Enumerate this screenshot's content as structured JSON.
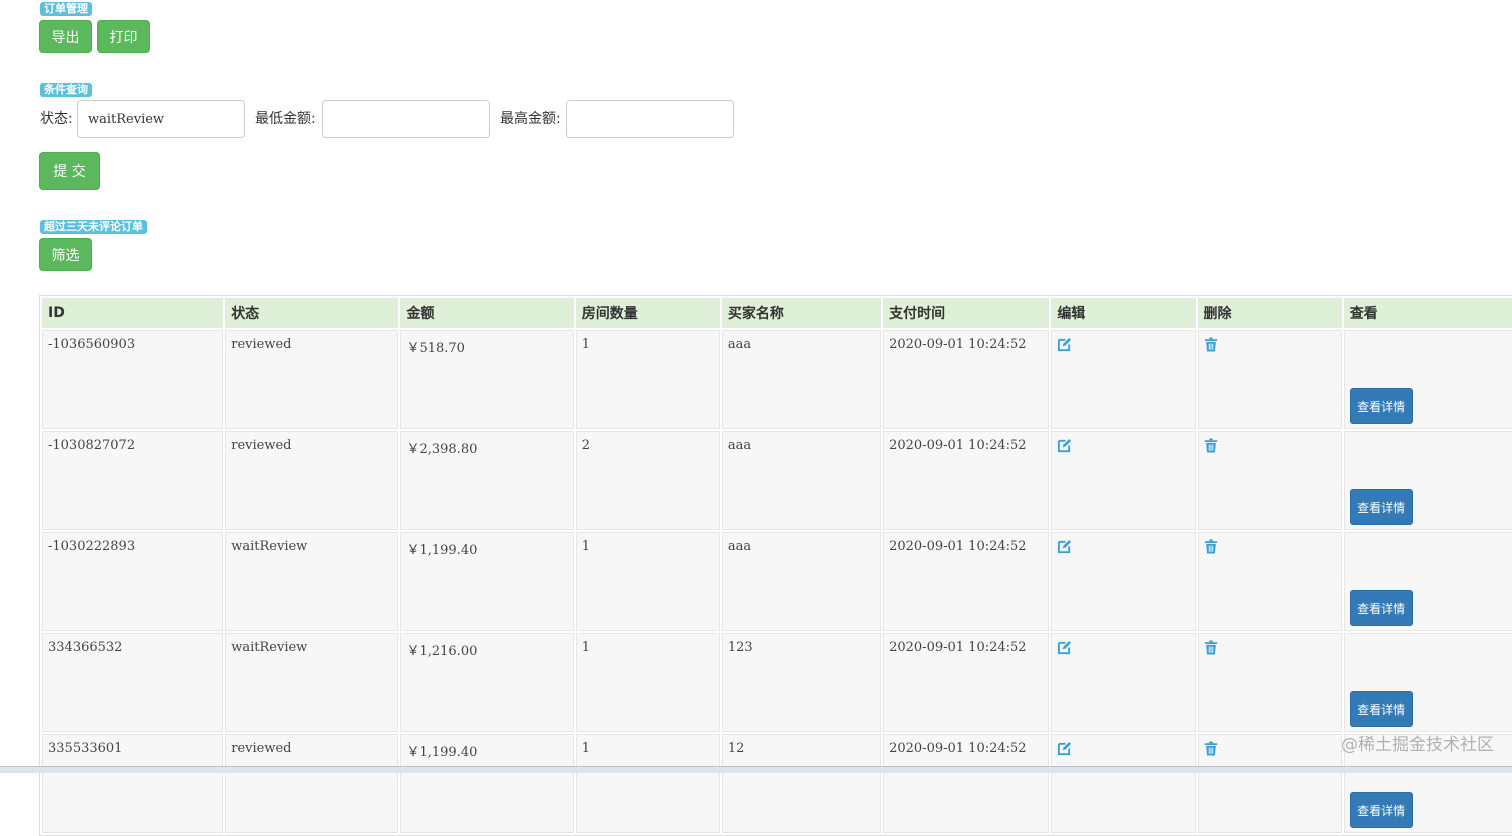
{
  "order_mgmt": {
    "badge": "订单管理",
    "export_label": "导出",
    "print_label": "打印"
  },
  "query": {
    "badge": "条件查询",
    "status_label": "状态:",
    "status_value": "waitReview",
    "min_label": "最低金额:",
    "min_value": "",
    "max_label": "最高金额:",
    "max_value": "",
    "submit_label": "提 交"
  },
  "overdue": {
    "badge": "超过三天未评论订单",
    "filter_label": "筛选"
  },
  "table": {
    "headers": [
      "ID",
      "状态",
      "金额",
      "房间数量",
      "买家名称",
      "支付时间",
      "编辑",
      "删除",
      "查看"
    ],
    "detail_label": "查看详情",
    "rows": [
      {
        "id": "-1036560903",
        "status": "reviewed",
        "amount": "￥518.70",
        "rooms": "1",
        "buyer": "aaa",
        "paid_at": "2020-09-01 10:24:52"
      },
      {
        "id": "-1030827072",
        "status": "reviewed",
        "amount": "￥2,398.80",
        "rooms": "2",
        "buyer": "aaa",
        "paid_at": "2020-09-01 10:24:52"
      },
      {
        "id": "-1030222893",
        "status": "waitReview",
        "amount": "￥1,199.40",
        "rooms": "1",
        "buyer": "aaa",
        "paid_at": "2020-09-01 10:24:52"
      },
      {
        "id": "334366532",
        "status": "waitReview",
        "amount": "￥1,216.00",
        "rooms": "1",
        "buyer": "123",
        "paid_at": "2020-09-01 10:24:52"
      },
      {
        "id": "335533601",
        "status": "reviewed",
        "amount": "￥1,199.40",
        "rooms": "1",
        "buyer": "12",
        "paid_at": "2020-09-01 10:24:52"
      }
    ]
  },
  "watermark": "@稀土掘金技术社区",
  "colors": {
    "success": "#5cb85c",
    "info": "#5bc0de",
    "primary": "#337ab7",
    "header_bg": "#dff0d8"
  },
  "icons": {
    "edit": "edit-icon",
    "delete": "trash-icon"
  }
}
